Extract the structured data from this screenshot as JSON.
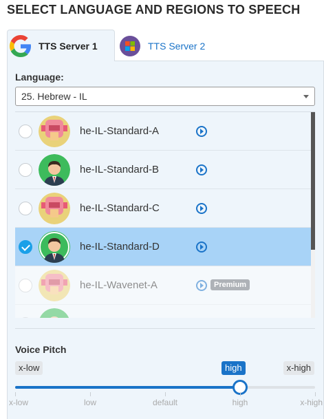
{
  "heading": "SELECT LANGUAGE AND REGIONS TO SPEECH",
  "tabs": [
    {
      "label": "TTS Server 1",
      "icon": "google-logo-icon",
      "active": true
    },
    {
      "label": "TTS Server 2",
      "icon": "windows-logo-icon",
      "active": false
    }
  ],
  "language": {
    "label": "Language:",
    "selected": "25. Hebrew - IL"
  },
  "voices": [
    {
      "name": "he-IL-Standard-A",
      "gender": "female",
      "selected": false,
      "premium": false,
      "disabled": false
    },
    {
      "name": "he-IL-Standard-B",
      "gender": "male",
      "selected": false,
      "premium": false,
      "disabled": false
    },
    {
      "name": "he-IL-Standard-C",
      "gender": "female",
      "selected": false,
      "premium": false,
      "disabled": false
    },
    {
      "name": "he-IL-Standard-D",
      "gender": "male",
      "selected": true,
      "premium": false,
      "disabled": false
    },
    {
      "name": "he-IL-Wavenet-A",
      "gender": "female",
      "selected": false,
      "premium": true,
      "disabled": true,
      "badge": "Premium"
    },
    {
      "name": "",
      "gender": "male",
      "selected": false,
      "premium": true,
      "disabled": true
    }
  ],
  "pitch": {
    "label": "Voice Pitch",
    "min_label": "x-low",
    "current_label": "high",
    "max_label": "x-high",
    "ticks": [
      "x-low",
      "low",
      "default",
      "high",
      "x-high"
    ],
    "value_index": 3
  },
  "colors": {
    "accent": "#1a73c8",
    "selected_row": "#a8d3f7",
    "panel": "#eef5fb"
  }
}
